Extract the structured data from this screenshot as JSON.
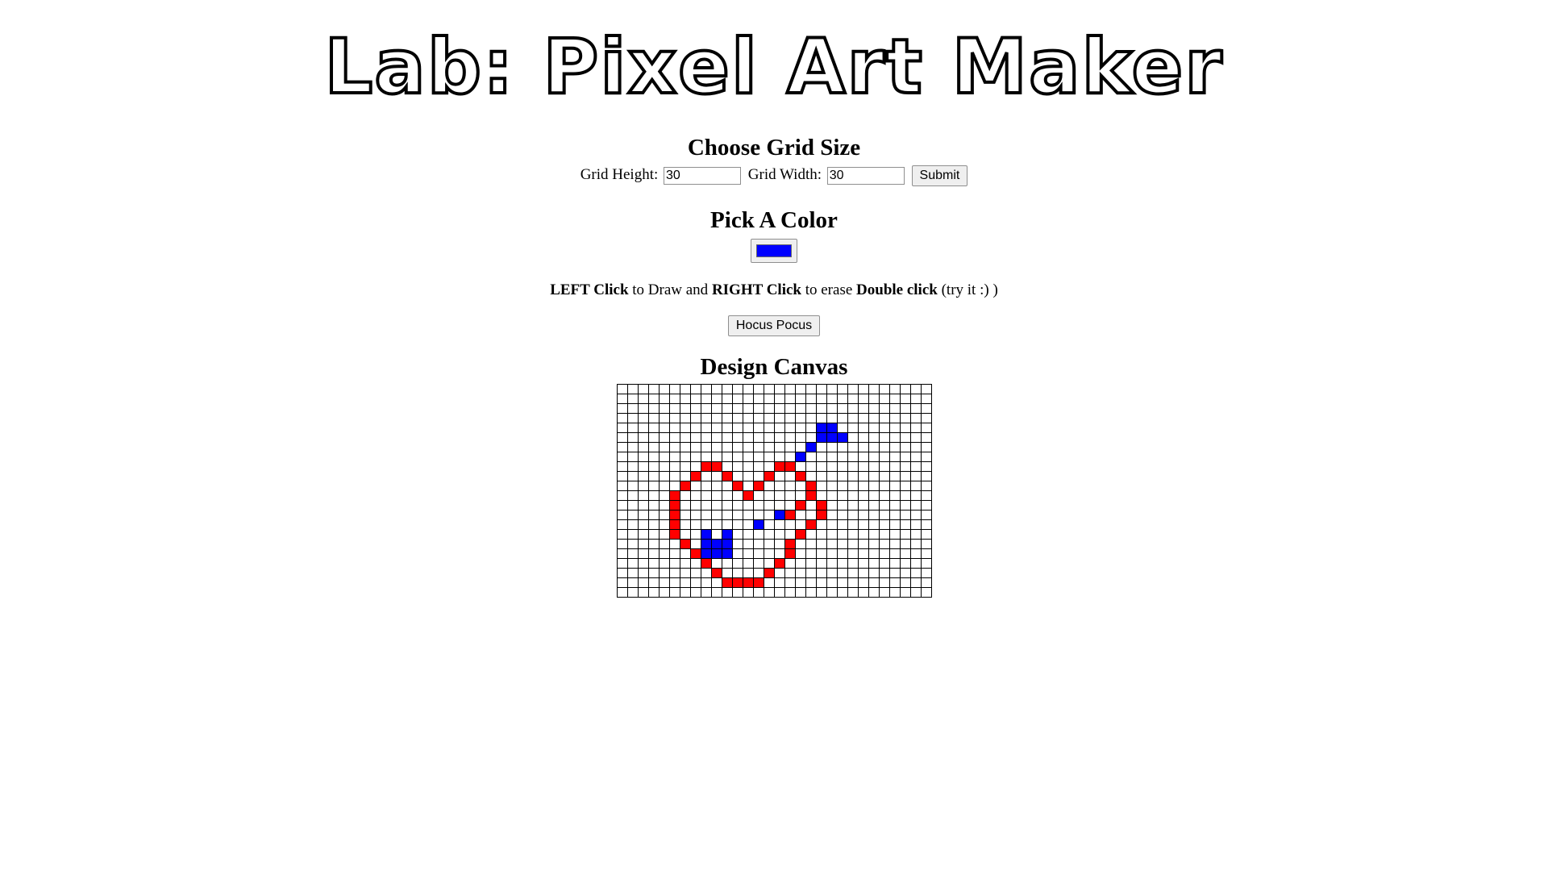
{
  "header": {
    "title": "Lab: Pixel Art Maker"
  },
  "size_section": {
    "heading": "Choose Grid Size",
    "height_label": "Grid Height:",
    "height_value": "30",
    "width_label": "Grid Width:",
    "width_value": "30",
    "submit_label": "Submit"
  },
  "color_section": {
    "heading": "Pick A Color",
    "selected_color": "#0000ff"
  },
  "instructions": {
    "left_click": "LEFT Click",
    "to_draw": " to Draw and ",
    "right_click": "RIGHT Click",
    "to_erase": " to erase ",
    "double_click": "Double click",
    "try_it": " (try it :) )"
  },
  "hocus_button": "Hocus Pocus",
  "canvas": {
    "heading": "Design Canvas",
    "rows": 22,
    "cols": 30,
    "colors": {
      "R": "#ff0000",
      "B": "#0000ff"
    },
    "pixels": [
      "..............................",
      "..............................",
      "..............................",
      "..............................",
      "...................BB.........",
      "...................BBB........",
      "..................B...........",
      ".................B............",
      "........RR.....RR.............",
      ".......R..R...R..R............",
      "......R....R.R....R...........",
      ".....R......R.....R...........",
      ".....R...........R.R..........",
      ".....R.........BR..R..........",
      ".....R.......B....R...........",
      ".....R..B.B......R............",
      "......R.BBB.....R.............",
      ".......RBBB.....R.............",
      "........R......R..............",
      ".........R....R...............",
      "..........RRRR................",
      ".............................."
    ]
  }
}
